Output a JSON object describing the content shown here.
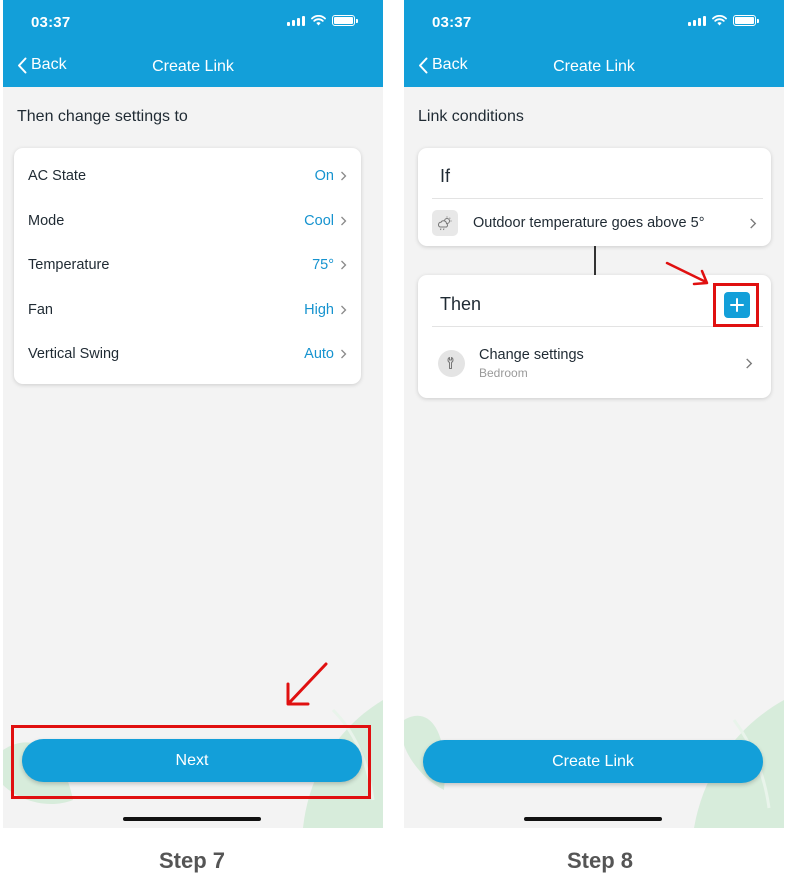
{
  "colors": {
    "accent": "#139fd9",
    "highlight": "#e01010",
    "value_text": "#1693cf"
  },
  "step7": {
    "status_time": "03:37",
    "back_label": "Back",
    "nav_title": "Create Link",
    "section_label": "Then change settings to",
    "settings": [
      {
        "label": "AC State",
        "value": "On"
      },
      {
        "label": "Mode",
        "value": "Cool"
      },
      {
        "label": "Temperature",
        "value": "75°"
      },
      {
        "label": "Fan",
        "value": "High"
      },
      {
        "label": "Vertical Swing",
        "value": "Auto"
      }
    ],
    "next_button": "Next",
    "caption": "Step 7"
  },
  "step8": {
    "status_time": "03:37",
    "back_label": "Back",
    "nav_title": "Create Link",
    "section_label": "Link conditions",
    "if_title": "If",
    "condition": {
      "icon": "weather-icon",
      "text": "Outdoor temperature goes above 5°"
    },
    "then_title": "Then",
    "action": {
      "icon": "wrench-icon",
      "title": "Change settings",
      "subtitle": "Bedroom"
    },
    "create_button": "Create Link",
    "caption": "Step 8"
  }
}
